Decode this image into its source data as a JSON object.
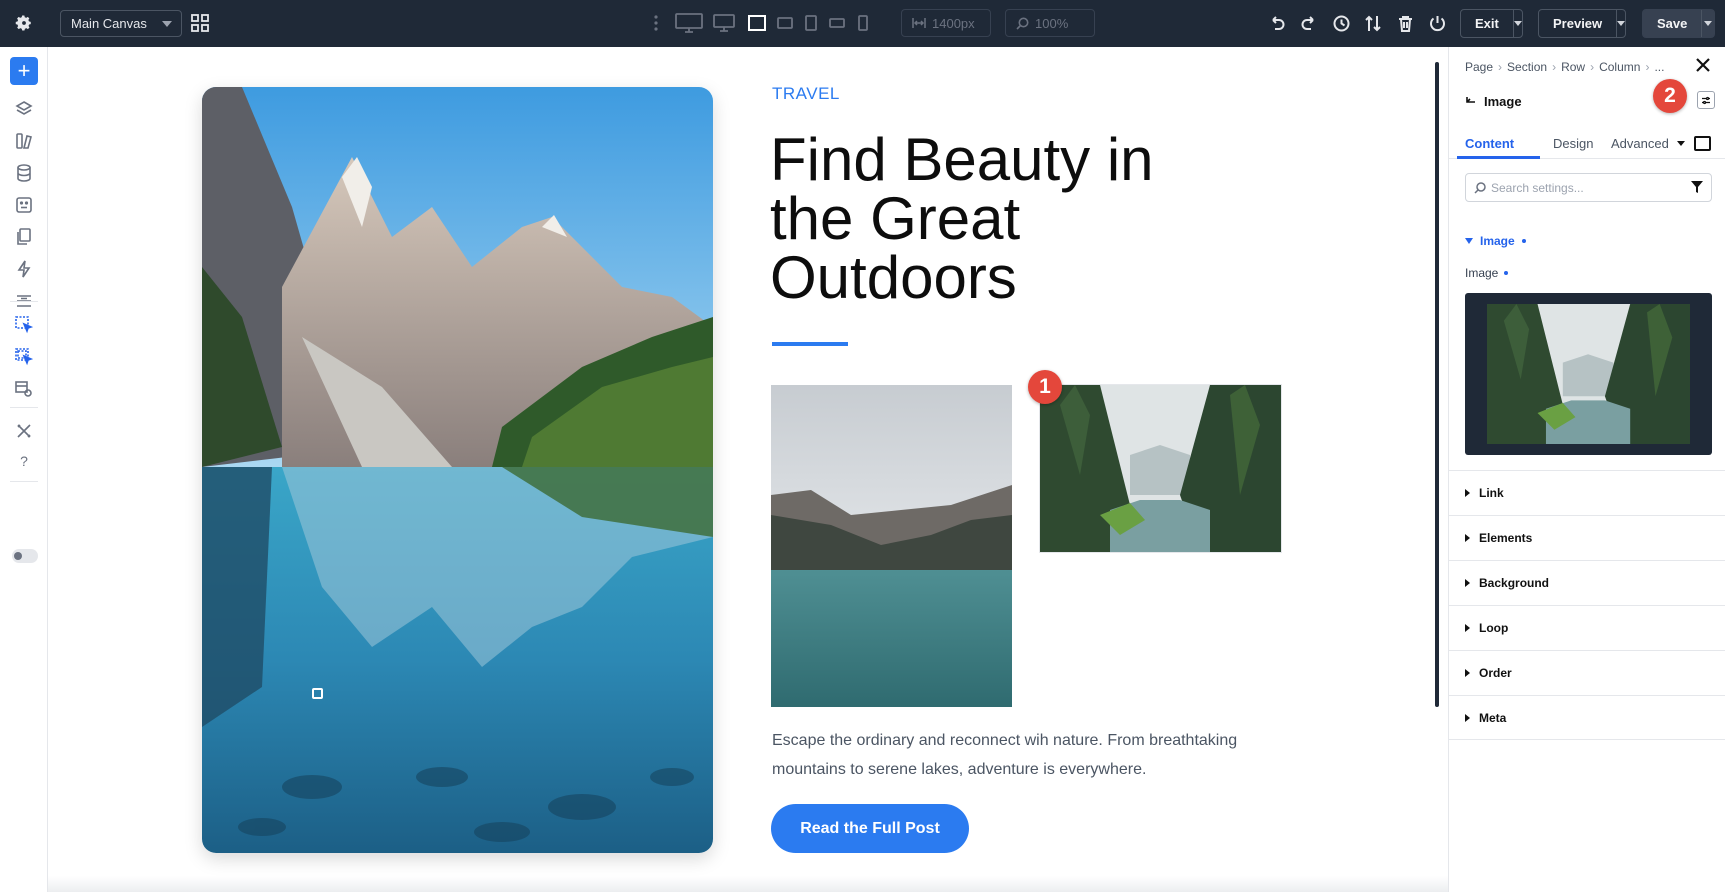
{
  "topbar": {
    "canvas_select": "Main Canvas",
    "width_value": "1400px",
    "zoom_value": "100%",
    "exit_label": "Exit",
    "preview_label": "Preview",
    "save_label": "Save"
  },
  "canvas": {
    "eyebrow": "TRAVEL",
    "headline": "Find Beauty in the Great Outdoors",
    "body": "Escape the ordinary and reconnect wih nature. From breathtaking mountains to serene lakes, adventure is everywhere.",
    "cta_label": "Read the Full Post",
    "badge_1": "1",
    "badge_2": "2"
  },
  "panel": {
    "breadcrumbs": [
      "Page",
      "Section",
      "Row",
      "Column",
      "..."
    ],
    "title": "Image",
    "tabs": [
      "Content",
      "Design",
      "Advanced"
    ],
    "active_tab": "Content",
    "search_placeholder": "Search settings...",
    "open_section": "Image",
    "field_label": "Image",
    "sections": [
      "Link",
      "Elements",
      "Background",
      "Loop",
      "Order",
      "Meta"
    ]
  },
  "colors": {
    "accent": "#2b7bf0",
    "topbar": "#1f2937",
    "badge": "#e4473b"
  }
}
